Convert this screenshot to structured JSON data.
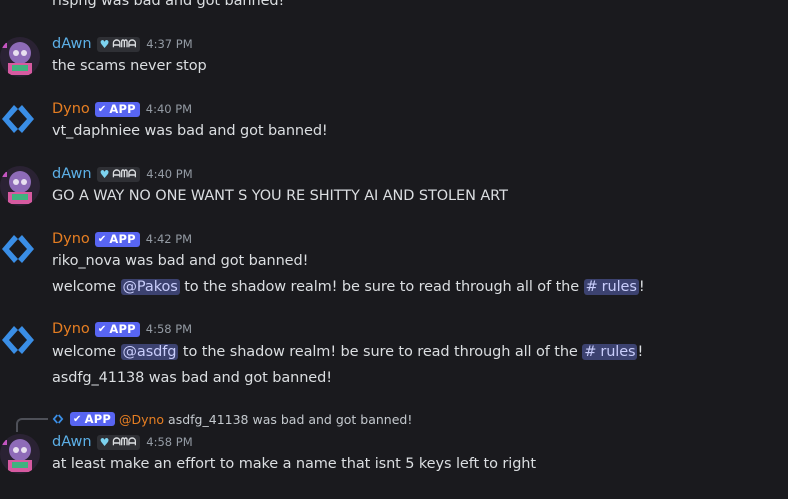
{
  "colors": {
    "background": "#1a1a1e",
    "dawn_name": "#5cafe6",
    "dyno_name": "#e67e22",
    "app_badge": "#5865f2",
    "mention_bg": "#3c4270"
  },
  "top_partial": {
    "text": "rispng was bad and got banned!"
  },
  "messages": [
    {
      "author": "dAwn",
      "guild_tag": "ᗩᗰᗩ",
      "time": "4:37 PM",
      "lines": [
        "the scams never stop"
      ]
    },
    {
      "author": "Dyno",
      "badge": "APP",
      "time": "4:40 PM",
      "lines": [
        "vt_daphniee was bad and got banned!"
      ]
    },
    {
      "author": "dAwn",
      "guild_tag": "ᗩᗰᗩ",
      "time": "4:40 PM",
      "lines": [
        "GO A WAY NO ONE WANT S YOU RE SHITTY AI AND STOLEN ART"
      ]
    },
    {
      "author": "Dyno",
      "badge": "APP",
      "time": "4:42 PM",
      "line1": "riko_nova was bad and got banned!",
      "welcome_pre": "welcome ",
      "mention": "@Pakos",
      "welcome_mid": " to the shadow realm! be sure to read through all of the ",
      "channel": "rules",
      "welcome_post": "!"
    },
    {
      "author": "Dyno",
      "badge": "APP",
      "time": "4:58 PM",
      "welcome_pre": "welcome ",
      "mention": "@asdfg",
      "welcome_mid": " to the shadow realm! be sure to read through all of the ",
      "channel": "rules",
      "welcome_post": "!",
      "line2": "asdfg_41138 was bad and got banned!"
    },
    {
      "author": "dAwn",
      "guild_tag": "ᗩᗰᗩ",
      "time": "4:58 PM",
      "reply": {
        "badge": "APP",
        "user": "@Dyno",
        "text": "asdfg_41138 was bad and got banned!"
      },
      "lines": [
        "at least make an effort to make a name that isnt 5 keys left to right"
      ]
    }
  ],
  "channel_hash": "#",
  "icons": {
    "avatar_dawn": "avatar",
    "dyno": "dyno-diamond-icon",
    "check": "check-icon",
    "heart": "heart-icon"
  }
}
